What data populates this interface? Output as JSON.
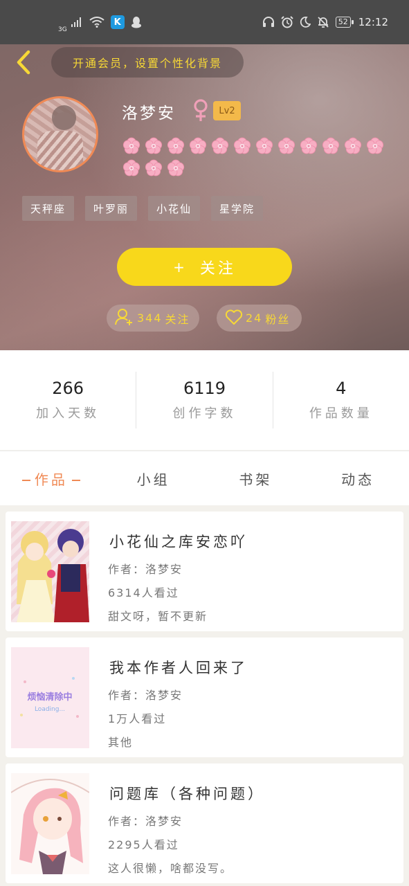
{
  "status_bar": {
    "network": "3G",
    "battery": "52",
    "time": "12:12",
    "app_badge": "K"
  },
  "header": {
    "vip_prompt": "开通会员，设置个性化背景",
    "username": "洛梦安",
    "gender_symbol": "♀",
    "level": "Lv2",
    "flower_count": 15,
    "tags": [
      "天秤座",
      "叶罗丽",
      "小花仙",
      "星学院"
    ],
    "follow_label": "关注",
    "follow_plus": "+",
    "following_count": "344",
    "following_label": "关注",
    "fans_count": "24",
    "fans_label": "粉丝"
  },
  "stats": [
    {
      "value": "266",
      "label": "加入天数"
    },
    {
      "value": "6119",
      "label": "创作字数"
    },
    {
      "value": "4",
      "label": "作品数量"
    }
  ],
  "tabs": [
    {
      "label": "作品",
      "active": true
    },
    {
      "label": "小组",
      "active": false
    },
    {
      "label": "书架",
      "active": false
    },
    {
      "label": "动态",
      "active": false
    }
  ],
  "works": [
    {
      "title": "小花仙之库安恋吖",
      "author_label": "作者：",
      "author": "洛梦安",
      "views": "6314",
      "views_suffix": "人看过",
      "status": "甜文呀，暂不更新"
    },
    {
      "title": "我本作者人回来了",
      "author_label": "作者：",
      "author": "洛梦安",
      "views": "1万",
      "views_suffix": "人看过",
      "status": "其他",
      "cover_text": "烦恼清除中",
      "cover_subtext": "Loading..."
    },
    {
      "title": "问题库（各种问题）",
      "author_label": "作者：",
      "author": "洛梦安",
      "views": "2295",
      "views_suffix": "人看过",
      "status": "这人很懒，啥都没写。"
    }
  ],
  "colors": {
    "accent": "#f08a55",
    "follow_button": "#f8d81b",
    "vip_text": "#f7d836",
    "level_badge": "#f3b94a",
    "gender": "#f0a0b8"
  }
}
